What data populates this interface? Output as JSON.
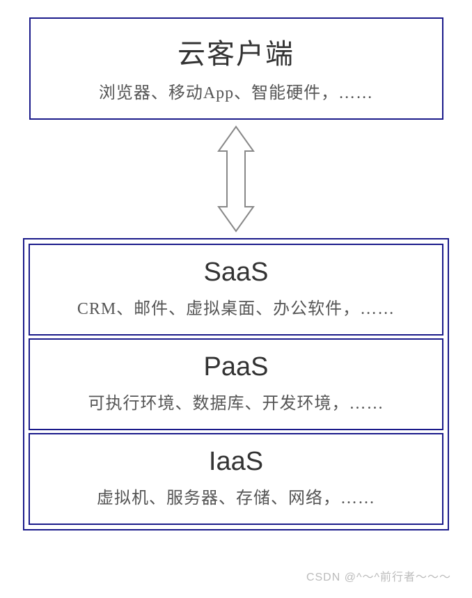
{
  "client": {
    "title": "云客户端",
    "subtitle": "浏览器、移动App、智能硬件，……"
  },
  "layers": [
    {
      "title": "SaaS",
      "subtitle": "CRM、邮件、虚拟桌面、办公软件，……"
    },
    {
      "title": "PaaS",
      "subtitle": "可执行环境、数据库、开发环境，……"
    },
    {
      "title": "IaaS",
      "subtitle": "虚拟机、服务器、存储、网络，……"
    }
  ],
  "watermark": "CSDN @^～^前行者～～～"
}
